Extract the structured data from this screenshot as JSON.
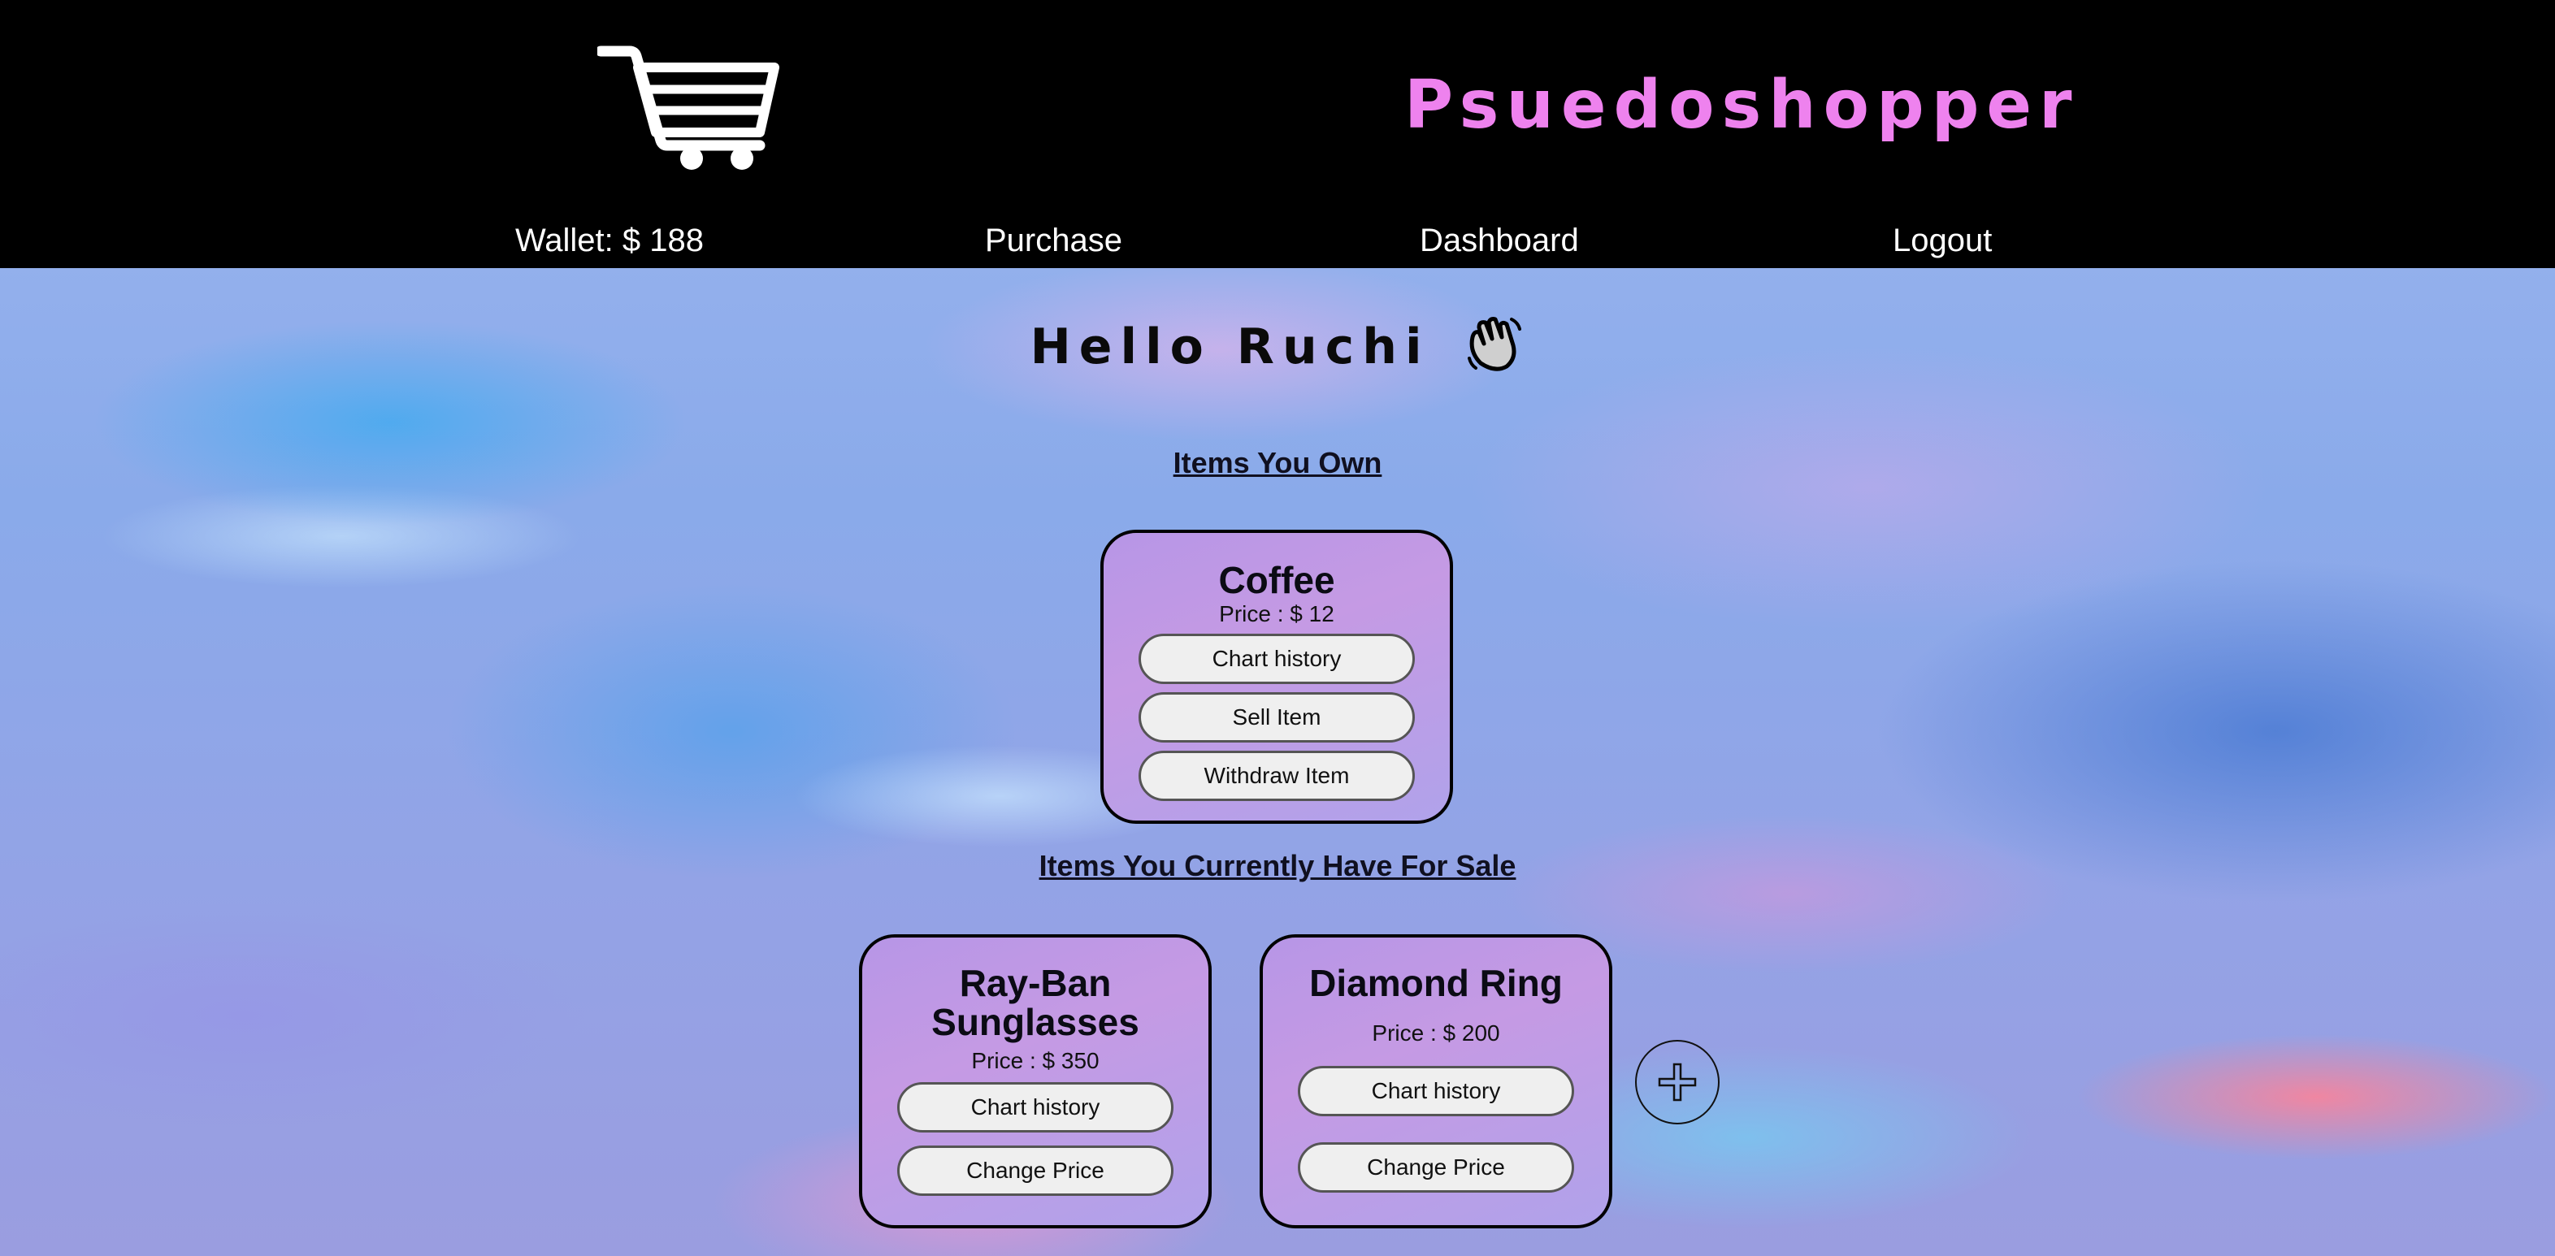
{
  "header": {
    "brand": "Psuedoshopper",
    "cart_icon": "shopping-cart-icon"
  },
  "nav": {
    "wallet_label": "Wallet: $",
    "wallet_amount": "188",
    "purchase": "Purchase",
    "dashboard": "Dashboard",
    "logout": "Logout"
  },
  "greeting": {
    "text": "Hello Ruchi",
    "icon": "waving-hand-icon"
  },
  "owned": {
    "heading": "Items You Own",
    "items": [
      {
        "name": "Coffee",
        "price": "Price : $ 12",
        "actions": [
          "Chart history",
          "Sell Item",
          "Withdraw Item"
        ]
      }
    ]
  },
  "for_sale": {
    "heading": "Items You Currently Have For Sale",
    "items": [
      {
        "name": "Ray-Ban Sunglasses",
        "price": "Price : $ 350",
        "actions": [
          "Chart history",
          "Change Price"
        ]
      },
      {
        "name": "Diamond Ring",
        "price": "Price : $ 200",
        "actions": [
          "Chart history",
          "Change Price"
        ]
      }
    ],
    "add_icon": "plus-icon"
  },
  "colors": {
    "brand": "#ee82ee",
    "header_bg": "#000000",
    "card_bg": "#b796e6",
    "button_bg": "#efefef"
  }
}
